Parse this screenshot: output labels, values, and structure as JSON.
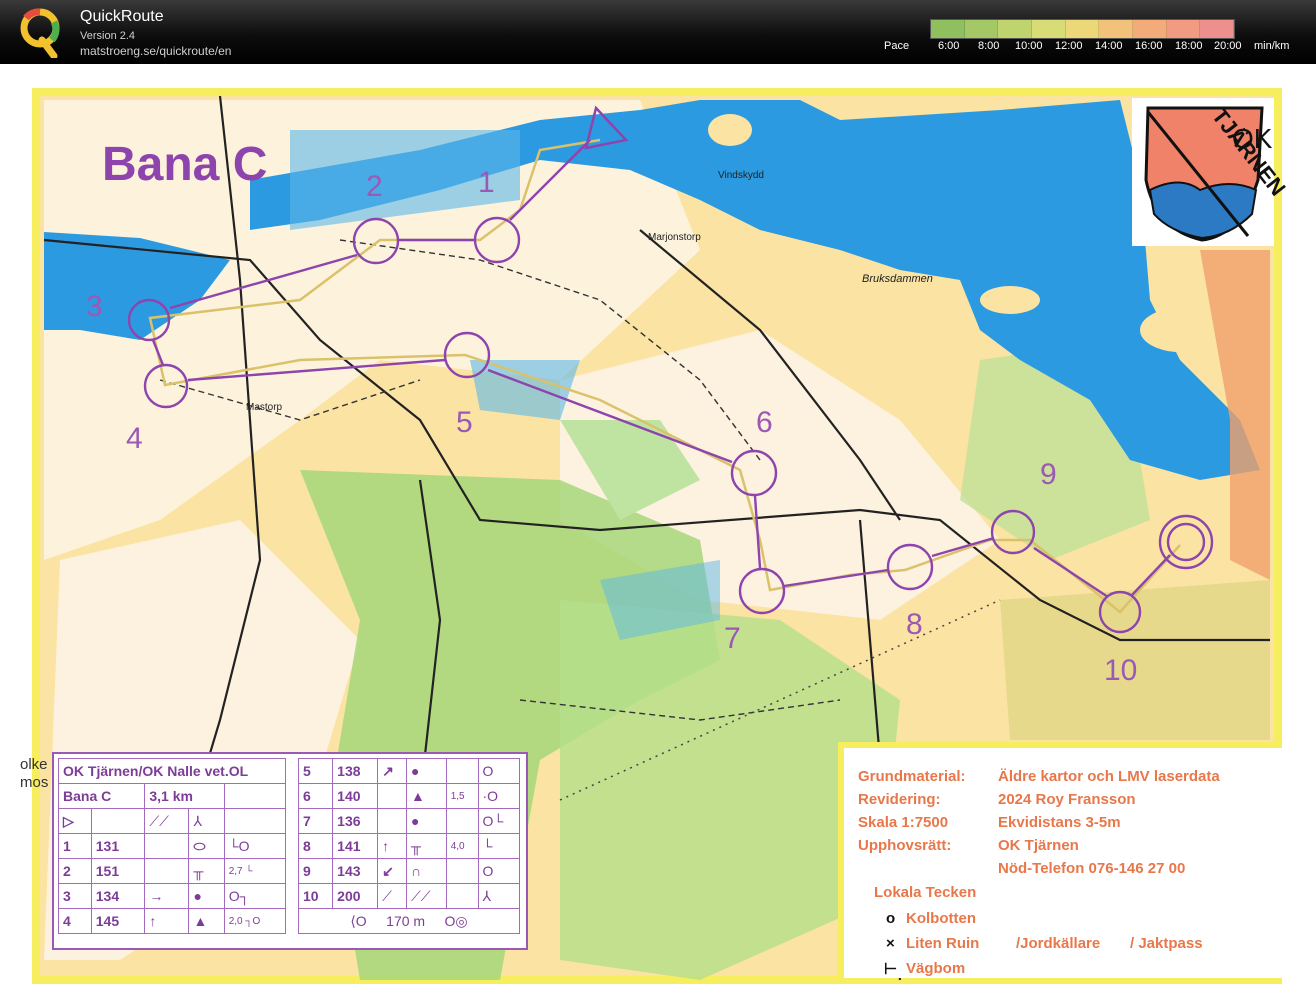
{
  "header": {
    "app_name": "QuickRoute",
    "version": "Version 2.4",
    "url": "matstroeng.se/quickroute/en",
    "pace_label": "Pace",
    "pace_ticks": [
      "6:00",
      "8:00",
      "10:00",
      "12:00",
      "14:00",
      "16:00",
      "18:00",
      "20:00",
      "min/km"
    ],
    "pace_gradient_colors": [
      "#8fbf5e",
      "#a4c865",
      "#bfd36e",
      "#d7dc76",
      "#ecd879",
      "#f2c27a",
      "#f3ab7a",
      "#f19b82",
      "#ec8f8d"
    ]
  },
  "map": {
    "course_title": "Bana C",
    "club_logo_text_tjarnen": "TJÄRNEN",
    "club_logo_text_ok": "OK",
    "place_names": {
      "vindskydd": "Vindskydd",
      "marjonstorp": "Marjonstorp",
      "bruksdammen": "Bruksdammen",
      "mastorp": "Mastorp"
    },
    "control_numbers": [
      "1",
      "2",
      "3",
      "4",
      "5",
      "6",
      "7",
      "8",
      "9",
      "10"
    ],
    "edge_text": [
      "olke",
      "mos"
    ],
    "colors": {
      "water": "#2c9ae0",
      "open_land": "#fbe3a3",
      "green": "#a6d77a",
      "course": "#8e44ad",
      "route": "#d9c26a",
      "border": "#f6ee5e"
    }
  },
  "description_sheet": {
    "title": "OK Tjärnen/OK Nalle vet.OL",
    "course": "Bana C",
    "length": "3,1 km",
    "left_rows": [
      {
        "n": "1",
        "code": "131",
        "dir": "",
        "sym": "oval",
        "feature": "",
        "dim": "",
        "extra": "└O"
      },
      {
        "n": "2",
        "code": "151",
        "dir": "",
        "sym": "wall",
        "feature": "",
        "dim": "2,7",
        "extra": "└"
      },
      {
        "n": "3",
        "code": "134",
        "dir": "→",
        "sym": "dot",
        "feature": "",
        "dim": "",
        "extra": "O┐"
      },
      {
        "n": "4",
        "code": "145",
        "dir": "↑",
        "sym": "triangle",
        "feature": "",
        "dim": "2,0",
        "extra": "┐O"
      }
    ],
    "right_rows": [
      {
        "n": "5",
        "code": "138",
        "dir": "↗",
        "sym": "dot",
        "dim": "",
        "extra": "O"
      },
      {
        "n": "6",
        "code": "140",
        "dir": "",
        "sym": "triangle",
        "dim": "1,5",
        "extra": "·O"
      },
      {
        "n": "7",
        "code": "136",
        "dir": "",
        "sym": "dot",
        "dim": "",
        "extra": "O└"
      },
      {
        "n": "8",
        "code": "141",
        "dir": "↑",
        "sym": "wall",
        "dim": "4,0",
        "extra": "└"
      },
      {
        "n": "9",
        "code": "143",
        "dir": "↙",
        "sym": "bump",
        "dim": "",
        "extra": "O"
      },
      {
        "n": "10",
        "code": "200",
        "dir": "",
        "sym": "",
        "dim": "",
        "extra": ""
      }
    ],
    "finish_distance": "170 m"
  },
  "map_info": {
    "rows": [
      {
        "label": "Grundmaterial:",
        "value": "Äldre kartor och LMV laserdata"
      },
      {
        "label": "Revidering:",
        "value": "2024 Roy Fransson"
      },
      {
        "label": "Skala 1:7500",
        "value": "Ekvidistans 3-5m"
      },
      {
        "label": "Upphovsrätt:",
        "value": "OK Tjärnen"
      },
      {
        "label": "",
        "value": "Nöd-Telefon 076-146 27 00"
      }
    ],
    "local_symbols_title": "Lokala Tecken",
    "local_symbols": [
      {
        "symbol": "o",
        "label": "Kolbotten"
      },
      {
        "symbol": "×",
        "label": "Liten Ruin",
        "extra1": "/Jordkällare",
        "extra2": "/ Jaktpass"
      },
      {
        "symbol": "⊢",
        "label": "Vägbom"
      }
    ]
  }
}
